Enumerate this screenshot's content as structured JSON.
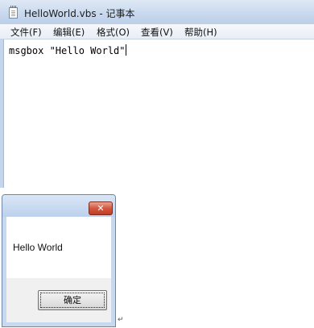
{
  "notepad": {
    "title": "HelloWorld.vbs - 记事本",
    "menu": [
      {
        "label": "文件(F)",
        "accesskey": "F"
      },
      {
        "label": "编辑(E)",
        "accesskey": "E"
      },
      {
        "label": "格式(O)",
        "accesskey": "O"
      },
      {
        "label": "查看(V)",
        "accesskey": "V"
      },
      {
        "label": "帮助(H)",
        "accesskey": "H"
      }
    ],
    "content": "msgbox \"Hello World\""
  },
  "dialog": {
    "message": "Hello World",
    "close_glyph": "✕",
    "ok_label": "确定"
  },
  "icons": {
    "notepad": "notepad-app-icon",
    "close": "close-icon"
  },
  "colors": {
    "titlebar": "#c9d9ee",
    "close_button": "#d2583f",
    "dialog_footer": "#f0f0f0"
  }
}
